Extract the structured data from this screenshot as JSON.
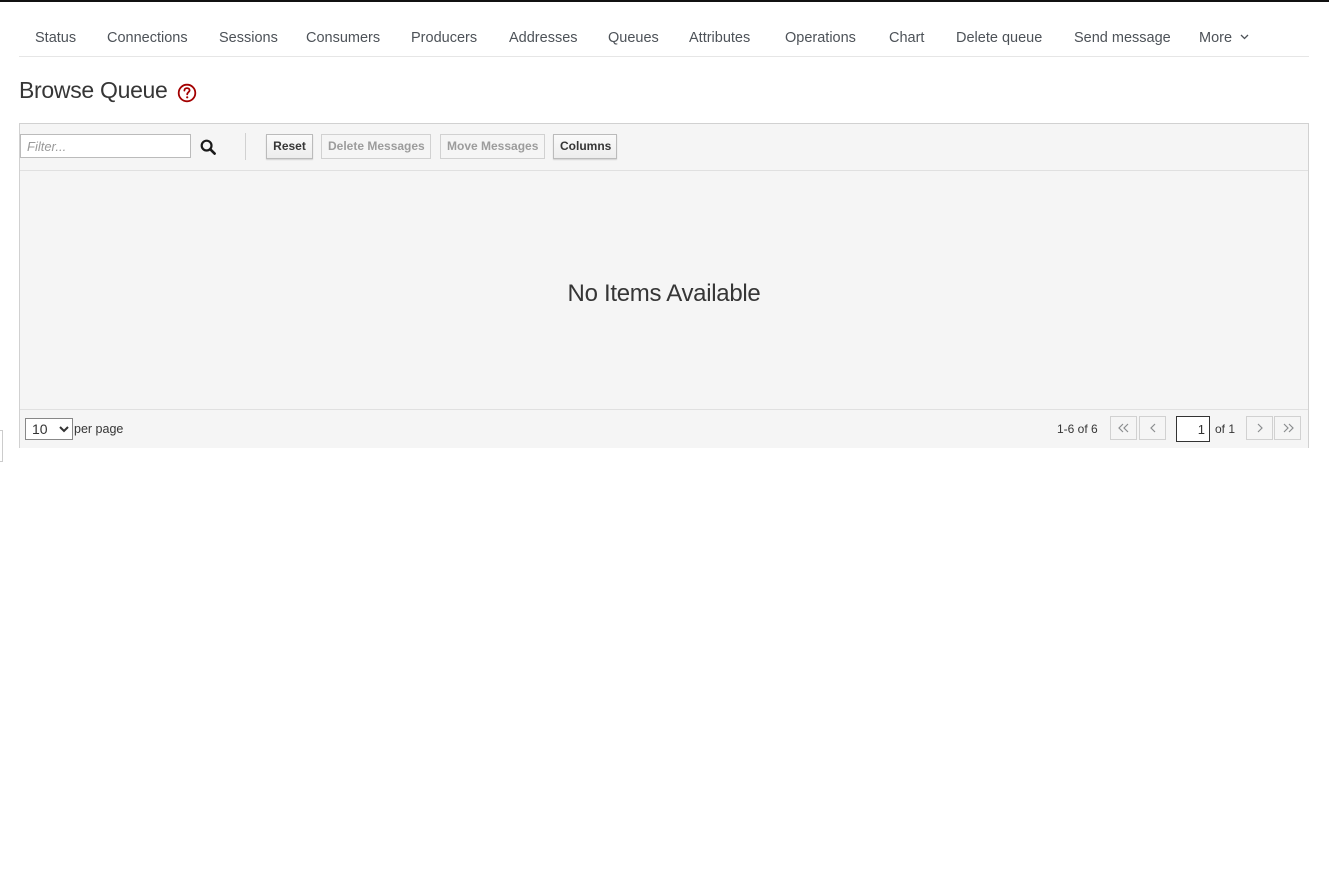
{
  "nav": {
    "items": [
      {
        "label": "Status"
      },
      {
        "label": "Connections"
      },
      {
        "label": "Sessions"
      },
      {
        "label": "Consumers"
      },
      {
        "label": "Producers"
      },
      {
        "label": "Addresses"
      },
      {
        "label": "Queues"
      },
      {
        "label": "Attributes"
      },
      {
        "label": "Operations"
      },
      {
        "label": "Chart"
      },
      {
        "label": "Delete queue"
      },
      {
        "label": "Send message"
      }
    ],
    "more_label": "More"
  },
  "page": {
    "title": "Browse Queue",
    "help_icon": "question-circle-icon",
    "accent_color": "#a30000"
  },
  "toolbar": {
    "filter_placeholder": "Filter...",
    "filter_value": "",
    "reset_label": "Reset",
    "delete_messages_label": "Delete Messages",
    "move_messages_label": "Move Messages",
    "columns_label": "Columns"
  },
  "table": {
    "empty_message": "No Items Available"
  },
  "pagination": {
    "per_page_options": [
      "10"
    ],
    "per_page_selected": "10",
    "per_page_label": "per page",
    "range_text": "1-6 of 6",
    "current_page": "1",
    "of_text": "of 1"
  }
}
